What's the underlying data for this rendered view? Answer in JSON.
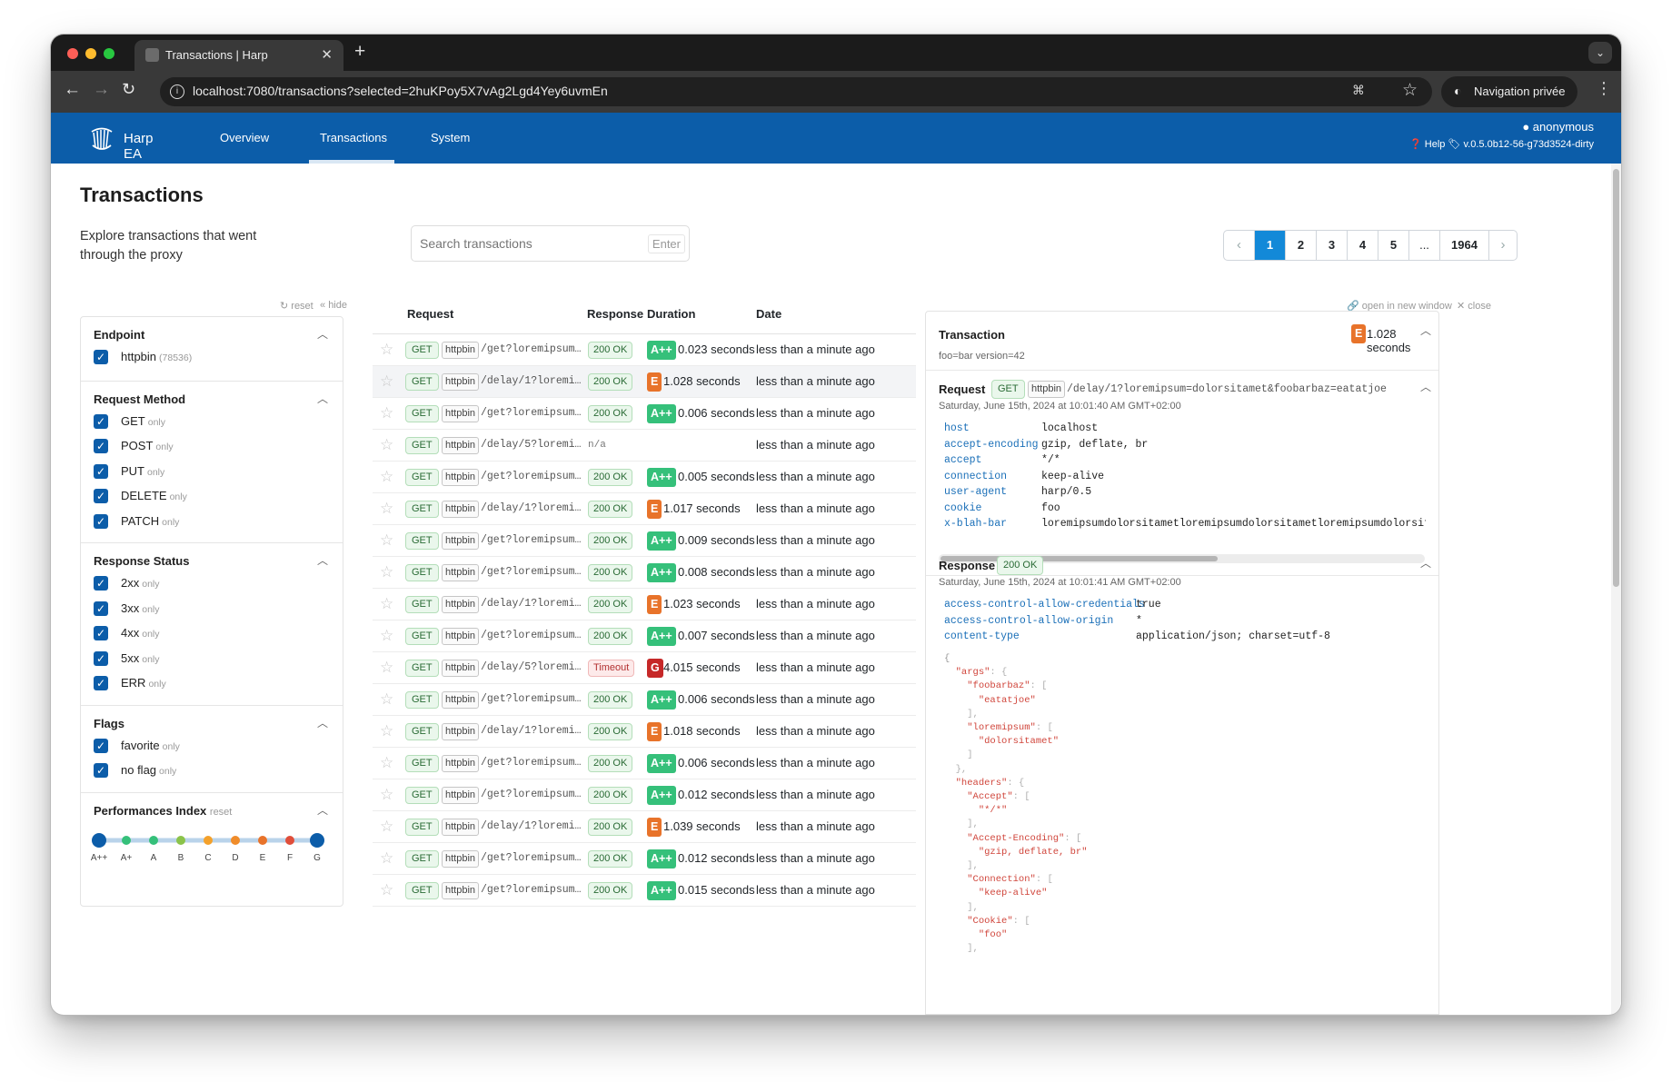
{
  "browser": {
    "tab_title": "Transactions | Harp",
    "url": "localhost:7080/transactions?selected=2huKPoy5X7vAg2Lgd4Yey6uvmEn",
    "incognito_label": "Navigation privée",
    "icons": [
      "back-icon",
      "forward-icon",
      "reload-icon",
      "info-icon",
      "translate-icon",
      "star-icon",
      "incognito-icon",
      "kebab-icon"
    ]
  },
  "app": {
    "brand": "Harp EA",
    "nav": [
      "Overview",
      "Transactions",
      "System"
    ],
    "active_nav": "Transactions",
    "user": "anonymous",
    "help": "Help",
    "version": "v.0.5.0b12-56-g73d3524-dirty",
    "colors": {
      "navbar": "#0c5da9",
      "accent": "#1389d8",
      "grade_a": "#35c07a",
      "grade_e": "#e8732a",
      "grade_g": "#c62828"
    }
  },
  "page": {
    "title": "Transactions",
    "description": "Explore transactions that went through the proxy",
    "search_placeholder": "Search transactions",
    "search_enter": "Enter",
    "pagination": [
      "1",
      "2",
      "3",
      "4",
      "5",
      "...",
      "1964"
    ],
    "current_page": "1"
  },
  "filters": {
    "reset": "reset",
    "hide": "hide",
    "endpoint": {
      "title": "Endpoint",
      "items": [
        {
          "label": "httpbin",
          "count": "(78536)"
        }
      ]
    },
    "method": {
      "title": "Request Method",
      "only": "only",
      "items": [
        "GET",
        "POST",
        "PUT",
        "DELETE",
        "PATCH"
      ]
    },
    "status": {
      "title": "Response Status",
      "only": "only",
      "items": [
        "2xx",
        "3xx",
        "4xx",
        "5xx",
        "ERR"
      ]
    },
    "flags": {
      "title": "Flags",
      "only": "only",
      "items": [
        "favorite",
        "no flag"
      ]
    },
    "perf": {
      "title": "Performances Index",
      "reset": "reset",
      "grades": [
        "A++",
        "A+",
        "A",
        "B",
        "C",
        "D",
        "E",
        "F",
        "G"
      ]
    }
  },
  "table": {
    "headers": [
      "Request",
      "Response",
      "Duration",
      "Date"
    ],
    "rows": [
      {
        "method": "GET",
        "endpoint": "httpbin",
        "path": "/get?loremipsum...",
        "status": "200 OK",
        "grade": "A++",
        "duration": "0.023 seconds",
        "date": "less than a minute ago"
      },
      {
        "method": "GET",
        "endpoint": "httpbin",
        "path": "/delay/1?loremi...",
        "status": "200 OK",
        "grade": "E",
        "duration": "1.028 seconds",
        "date": "less than a minute ago",
        "selected": true
      },
      {
        "method": "GET",
        "endpoint": "httpbin",
        "path": "/get?loremipsum...",
        "status": "200 OK",
        "grade": "A++",
        "duration": "0.006 seconds",
        "date": "less than a minute ago"
      },
      {
        "method": "GET",
        "endpoint": "httpbin",
        "path": "/delay/5?loremi...",
        "status": "n/a",
        "grade": "",
        "duration": "",
        "date": "less than a minute ago"
      },
      {
        "method": "GET",
        "endpoint": "httpbin",
        "path": "/get?loremipsum...",
        "status": "200 OK",
        "grade": "A++",
        "duration": "0.005 seconds",
        "date": "less than a minute ago"
      },
      {
        "method": "GET",
        "endpoint": "httpbin",
        "path": "/delay/1?loremi...",
        "status": "200 OK",
        "grade": "E",
        "duration": "1.017 seconds",
        "date": "less than a minute ago"
      },
      {
        "method": "GET",
        "endpoint": "httpbin",
        "path": "/get?loremipsum...",
        "status": "200 OK",
        "grade": "A++",
        "duration": "0.009 seconds",
        "date": "less than a minute ago"
      },
      {
        "method": "GET",
        "endpoint": "httpbin",
        "path": "/get?loremipsum...",
        "status": "200 OK",
        "grade": "A++",
        "duration": "0.008 seconds",
        "date": "less than a minute ago"
      },
      {
        "method": "GET",
        "endpoint": "httpbin",
        "path": "/delay/1?loremi...",
        "status": "200 OK",
        "grade": "E",
        "duration": "1.023 seconds",
        "date": "less than a minute ago"
      },
      {
        "method": "GET",
        "endpoint": "httpbin",
        "path": "/get?loremipsum...",
        "status": "200 OK",
        "grade": "A++",
        "duration": "0.007 seconds",
        "date": "less than a minute ago"
      },
      {
        "method": "GET",
        "endpoint": "httpbin",
        "path": "/delay/5?loremi...",
        "status": "Timeout",
        "grade": "G",
        "duration": "4.015 seconds",
        "date": "less than a minute ago"
      },
      {
        "method": "GET",
        "endpoint": "httpbin",
        "path": "/get?loremipsum...",
        "status": "200 OK",
        "grade": "A++",
        "duration": "0.006 seconds",
        "date": "less than a minute ago"
      },
      {
        "method": "GET",
        "endpoint": "httpbin",
        "path": "/delay/1?loremi...",
        "status": "200 OK",
        "grade": "E",
        "duration": "1.018 seconds",
        "date": "less than a minute ago"
      },
      {
        "method": "GET",
        "endpoint": "httpbin",
        "path": "/get?loremipsum...",
        "status": "200 OK",
        "grade": "A++",
        "duration": "0.006 seconds",
        "date": "less than a minute ago"
      },
      {
        "method": "GET",
        "endpoint": "httpbin",
        "path": "/get?loremipsum...",
        "status": "200 OK",
        "grade": "A++",
        "duration": "0.012 seconds",
        "date": "less than a minute ago"
      },
      {
        "method": "GET",
        "endpoint": "httpbin",
        "path": "/delay/1?loremi...",
        "status": "200 OK",
        "grade": "E",
        "duration": "1.039 seconds",
        "date": "less than a minute ago"
      },
      {
        "method": "GET",
        "endpoint": "httpbin",
        "path": "/get?loremipsum...",
        "status": "200 OK",
        "grade": "A++",
        "duration": "0.012 seconds",
        "date": "less than a minute ago"
      },
      {
        "method": "GET",
        "endpoint": "httpbin",
        "path": "/get?loremipsum...",
        "status": "200 OK",
        "grade": "A++",
        "duration": "0.015 seconds",
        "date": "less than a minute ago"
      }
    ]
  },
  "detail": {
    "open_new_window": "open in new window",
    "close": "close",
    "transaction_label": "Transaction",
    "transaction_grade": "E",
    "transaction_duration": "1.028 seconds",
    "tags": "foo=bar version=42",
    "request": {
      "label": "Request",
      "method": "GET",
      "endpoint": "httpbin",
      "path": "/delay/1?loremipsum=dolorsitamet&foobarbaz=eatatjoe",
      "date": "Saturday, June 15th, 2024 at 10:01:40 AM GMT+02:00",
      "headers": [
        {
          "k": "host",
          "v": "localhost"
        },
        {
          "k": "accept-encoding",
          "v": "gzip, deflate, br"
        },
        {
          "k": "accept",
          "v": "*/*"
        },
        {
          "k": "connection",
          "v": "keep-alive"
        },
        {
          "k": "user-agent",
          "v": "harp/0.5"
        },
        {
          "k": "cookie",
          "v": "foo"
        },
        {
          "k": "x-blah-bar",
          "v": "loremipsumdolorsitametloremipsumdolorsitametloremipsumdolorsitametlor"
        }
      ]
    },
    "response": {
      "label": "Response",
      "status": "200 OK",
      "date": "Saturday, June 15th, 2024 at 10:01:41 AM GMT+02:00",
      "headers": [
        {
          "k": "access-control-allow-credentials",
          "v": "true"
        },
        {
          "k": "access-control-allow-origin",
          "v": "*"
        },
        {
          "k": "content-type",
          "v": "application/json; charset=utf-8"
        }
      ],
      "body_lines": [
        [
          "{",
          ""
        ],
        [
          "  ",
          "\"args\"",
          ": {"
        ],
        [
          "    ",
          "\"foobarbaz\"",
          ": ["
        ],
        [
          "      ",
          "\"eatatjoe\"",
          ""
        ],
        [
          "    ",
          "",
          "],"
        ],
        [
          "    ",
          "\"loremipsum\"",
          ": ["
        ],
        [
          "      ",
          "\"dolorsitamet\"",
          ""
        ],
        [
          "    ",
          "",
          "]"
        ],
        [
          "  ",
          "",
          "},"
        ],
        [
          "  ",
          "\"headers\"",
          ": {"
        ],
        [
          "    ",
          "\"Accept\"",
          ": ["
        ],
        [
          "      ",
          "\"*/*\"",
          ""
        ],
        [
          "    ",
          "",
          "],"
        ],
        [
          "    ",
          "\"Accept-Encoding\"",
          ": ["
        ],
        [
          "      ",
          "\"gzip, deflate, br\"",
          ""
        ],
        [
          "    ",
          "",
          "],"
        ],
        [
          "    ",
          "\"Connection\"",
          ": ["
        ],
        [
          "      ",
          "\"keep-alive\"",
          ""
        ],
        [
          "    ",
          "",
          "],"
        ],
        [
          "    ",
          "\"Cookie\"",
          ": ["
        ],
        [
          "      ",
          "\"foo\"",
          ""
        ],
        [
          "    ",
          "",
          "],"
        ]
      ]
    }
  }
}
